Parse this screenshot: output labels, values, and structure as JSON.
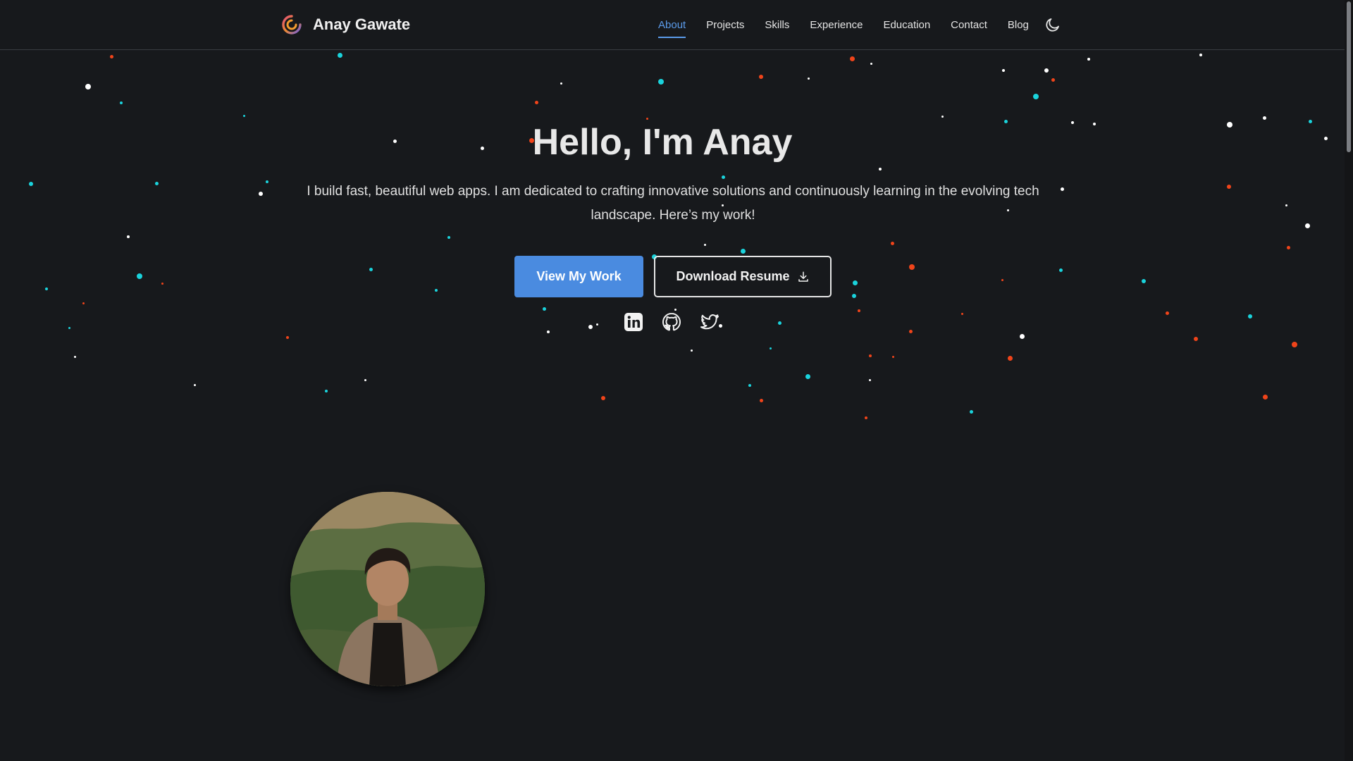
{
  "brand": {
    "name": "Anay Gawate",
    "logo_icon": "spiral-logo-icon"
  },
  "nav": {
    "items": [
      {
        "label": "About",
        "active": true
      },
      {
        "label": "Projects",
        "active": false
      },
      {
        "label": "Skills",
        "active": false
      },
      {
        "label": "Experience",
        "active": false
      },
      {
        "label": "Education",
        "active": false
      },
      {
        "label": "Contact",
        "active": false
      },
      {
        "label": "Blog",
        "active": false
      }
    ],
    "theme_toggle_icon": "moon-icon"
  },
  "hero": {
    "title": "Hello, I'm Anay",
    "subtitle": "I build fast, beautiful web apps. I am dedicated to crafting innovative solutions and continuously learning in the evolving tech landscape. Here’s my work!",
    "primary_button": "View My Work",
    "secondary_button": "Download Resume",
    "secondary_button_icon": "download-icon",
    "socials": [
      "linkedin-icon",
      "github-icon",
      "twitter-icon"
    ]
  },
  "profile": {
    "avatar_icon": "profile-photo"
  },
  "colors": {
    "background": "#17191c",
    "accent": "#4a8be0",
    "active_link": "#5b9bea",
    "particle_cyan": "#1ad3dc",
    "particle_orange": "#f0441a",
    "particle_white": "#ffffff"
  }
}
